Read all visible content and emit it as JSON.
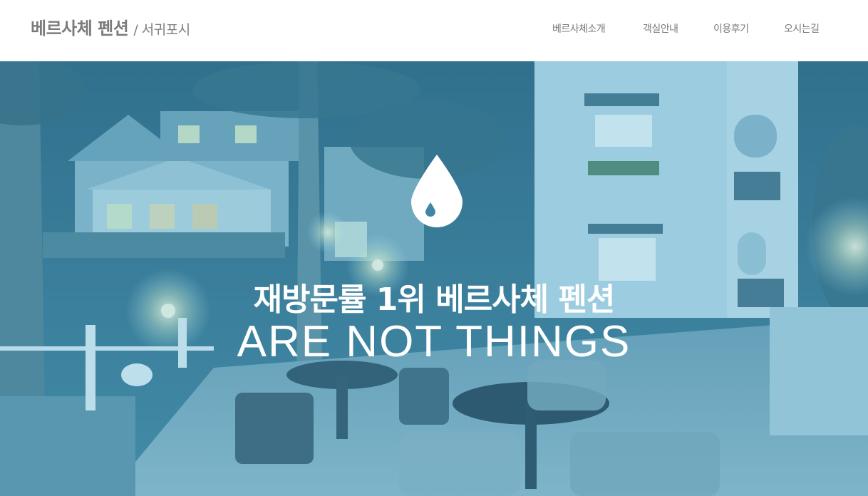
{
  "header": {
    "brand_name": "베르사체 펜션",
    "brand_sub": "/ 서귀포시",
    "nav": [
      "베르사체소개",
      "객실안내",
      "이용후기",
      "오시는길"
    ]
  },
  "hero": {
    "title": "재방문률 1위 베르사체 펜션",
    "subtitle": "ARE NOT THINGS",
    "icon": "water-drop-icon"
  },
  "colors": {
    "accent_overlay": "#54acd2",
    "text_gray": "#7b7b7b"
  }
}
